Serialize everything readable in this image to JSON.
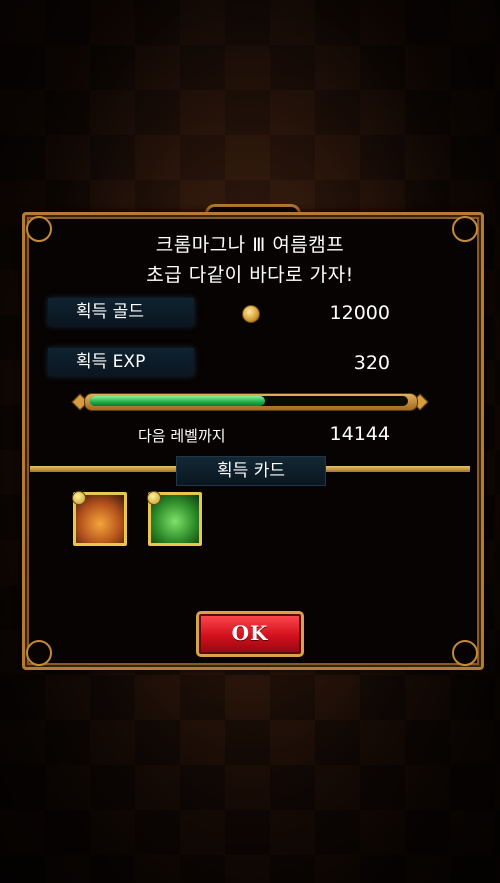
{
  "dialog": {
    "title_line1": "크롬마그나 Ⅲ 여름캠프",
    "title_line2": "초급 다같이 바다로 가자!"
  },
  "rewards": {
    "gold_label": "획득 골드",
    "gold_value": "12000",
    "gold_icon": "coin-icon",
    "exp_label": "획득 EXP",
    "exp_value": "320",
    "exp_progress": 0.55,
    "next_level_label": "다음 레벨까지",
    "next_level_value": "14144"
  },
  "cards": {
    "header": "획득 카드",
    "items": [
      {
        "name": "flame-beast-card"
      },
      {
        "name": "green-dragon-card"
      }
    ]
  },
  "buttons": {
    "ok_label": "OK"
  },
  "colors": {
    "frame_gold": "#b57a34",
    "progress_green": "#1fae45",
    "ok_red": "#d3101c"
  }
}
